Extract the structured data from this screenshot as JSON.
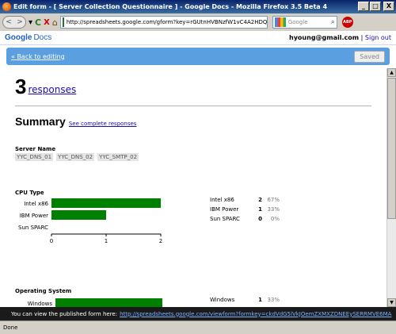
{
  "window": {
    "title": "Edit form - [ Server Collection Questionnaire ] - Google Docs - Mozilla Firefox 3.5 Beta 4",
    "controls": [
      "_",
      "□",
      "X"
    ]
  },
  "toolbar": {
    "back": "<",
    "forward": ">",
    "dropdown": "▾",
    "reload": "C",
    "stop": "X",
    "home": "⌂",
    "url": "http://spreadsheets.google.com/gform?key=rGUtnHVBNzfW1vC4A2HDQ1",
    "star": "☆",
    "search_placeholder": "Google",
    "search_icon": "magnifier-icon",
    "adblock": "ABP"
  },
  "header": {
    "logo_google": "Google",
    "logo_docs": "Docs",
    "email": "hyoung@gmail.com",
    "separator": "|",
    "signout": "Sign out"
  },
  "editbar": {
    "back_link": "« Back to editing",
    "saved_label": "Saved"
  },
  "summary": {
    "count": "3",
    "responses_label": "responses",
    "heading": "Summary",
    "see_all": "See complete responses"
  },
  "questions": {
    "server_name": {
      "title": "Server Name",
      "answers": [
        "YYC_DNS_01",
        "YYC_DNS_02",
        "YYC_SMTP_02"
      ]
    },
    "cpu_type": {
      "title": "CPU Type",
      "rows": [
        {
          "label": "Intel x86",
          "count": "2",
          "pct": "67%"
        },
        {
          "label": "IBM Power",
          "count": "1",
          "pct": "33%"
        },
        {
          "label": "Sun SPARC",
          "count": "0",
          "pct": "0%"
        }
      ]
    },
    "operating_system": {
      "title": "Operating System",
      "rows": [
        {
          "label": "Windows",
          "count": "1",
          "pct": "33%"
        }
      ]
    }
  },
  "chart_data": [
    {
      "type": "bar",
      "orientation": "horizontal",
      "title": "CPU Type",
      "categories": [
        "Intel x86",
        "IBM Power",
        "Sun SPARC"
      ],
      "values": [
        2,
        1,
        0
      ],
      "xlim": [
        0,
        2
      ],
      "xticks": [
        "0",
        "1",
        "2"
      ],
      "color": "#008000"
    },
    {
      "type": "bar",
      "orientation": "horizontal",
      "title": "Operating System",
      "categories": [
        "Windows"
      ],
      "values": [
        1
      ],
      "xlim": [
        0,
        1
      ],
      "color": "#008000"
    }
  ],
  "notice": {
    "text": "You can view the published form here:",
    "link": "http://spreadsheets.google.com/viewform?formkey=ckdVdG5lVkJOemZXMXZDNEEySERRMVE6MA"
  },
  "status": {
    "text": "Done"
  }
}
